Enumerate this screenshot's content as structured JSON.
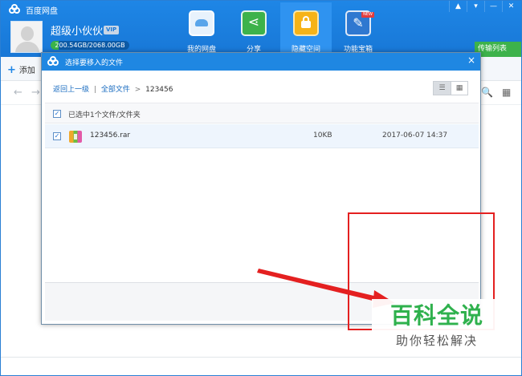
{
  "app": {
    "title": "百度网盘",
    "username": "超级小伙伙",
    "vip_label": "VIP",
    "quota_text": "200.54GB/2068.00GB",
    "quota_fraction": 0.097
  },
  "nav": {
    "items": [
      {
        "label": "我的网盘",
        "icon": "cloud-drive-icon"
      },
      {
        "label": "分享",
        "icon": "share-icon"
      },
      {
        "label": "隐藏空间",
        "icon": "lock-icon"
      },
      {
        "label": "功能宝箱",
        "icon": "toolbox-icon"
      }
    ],
    "new_badge": "NEW"
  },
  "window_controls": {
    "pin": "▲",
    "menu": "▾",
    "minimize": "—",
    "close": "✕"
  },
  "transfer_button": "传输列表",
  "toolbar": {
    "add_label": "添加",
    "add_symbol": "+"
  },
  "navrow": {
    "back": "←",
    "forward": "→",
    "search": "🔍",
    "grid": "▦"
  },
  "dialog": {
    "title": "选择要移入的文件",
    "close": "×",
    "breadcrumb": {
      "back_link": "返回上一级",
      "separator": "|",
      "all_files": "全部文件",
      "arrow": ">",
      "current": "123456"
    },
    "view_list_icon": "☰",
    "view_grid_icon": "▦",
    "selected_text": "已选中1个文件/文件夹",
    "check_mark": "✓",
    "files": [
      {
        "name": "123456.rar",
        "size": "10KB",
        "date": "2017-06-07 14:37",
        "icon": "rar-archive-icon",
        "checked": true
      }
    ]
  },
  "watermark": {
    "title": "百科全说",
    "subtitle": "助你轻松解决"
  },
  "colors": {
    "brand_blue": "#1e86e6",
    "green": "#3db24b",
    "highlight_red": "#e42020",
    "watermark_green": "#2fb14d"
  }
}
